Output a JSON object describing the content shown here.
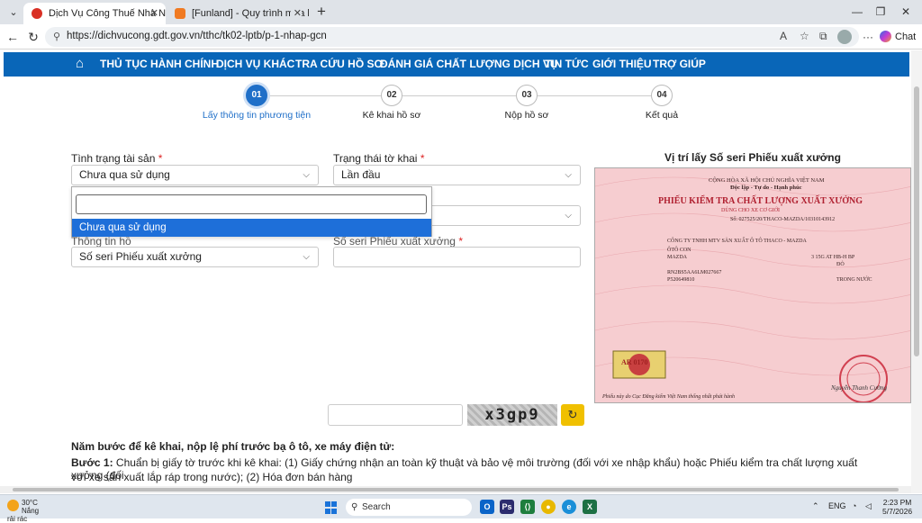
{
  "browser": {
    "tabs": [
      {
        "title": "Dịch Vụ Công Thuế Nhà Nước",
        "active": true
      },
      {
        "title": "[Funland] - Quy trình mua bán xe",
        "active": false
      }
    ],
    "url": "https://dichvucong.gdt.gov.vn/tthc/tk02-lptb/p-1-nhap-gcn",
    "chat_label": "Chat"
  },
  "menu": {
    "items": [
      "THỦ TỤC HÀNH CHÍNH",
      "DỊCH VỤ KHÁC",
      "TRA CỨU HỒ SƠ",
      "ĐÁNH GIÁ CHẤT LƯỢNG DỊCH VỤ",
      "TIN TỨC",
      "GIỚI THIỆU",
      "TRỢ GIÚP"
    ]
  },
  "steps": [
    {
      "num": "01",
      "label": "Lấy thông tin phương tiện",
      "active": true
    },
    {
      "num": "02",
      "label": "Kê khai hồ sơ",
      "active": false
    },
    {
      "num": "03",
      "label": "Nộp hồ sơ",
      "active": false
    },
    {
      "num": "04",
      "label": "Kết quả",
      "active": false
    }
  ],
  "form": {
    "asset_status_label": "Tình trạng tài sản",
    "asset_status_value": "Chưa qua sử dụng",
    "declaration_status_label": "Trạng thái tờ khai",
    "declaration_status_value": "Lần đầu",
    "info_type_label": "Thông tin hồ",
    "info_type_value": "Số seri Phiếu xuất xưởng",
    "serial_number_label": "Số seri Phiếu xuất xưởng",
    "required_mark": "*",
    "dropdown_option": "Chưa qua sử dụng"
  },
  "certificate": {
    "panel_title": "Vị trí lấy Số seri Phiếu xuất xưởng",
    "header1": "CỘNG HÒA XÃ HỘI CHỦ NGHĨA VIỆT NAM",
    "header2": "Độc lập - Tự do - Hạnh phúc",
    "title": "PHIẾU KIỂM TRA CHẤT LƯỢNG XUẤT XƯỞNG",
    "subtitle": "DÙNG CHO XE CƠ GIỚI",
    "serial_line": "Số: 027525/20/THACO-MAZDA/10310143912",
    "manufacturer": "CÔNG TY TNHH MTV SẢN XUẤT Ô TÔ THACO - MAZDA",
    "product": "ÔTÔ CON",
    "brand": "MAZDA",
    "model": "3 15G AT HB-H BP",
    "color": "ĐỎ",
    "chassis": "RN2BS5AA6LM027667",
    "engine": "P520649810",
    "origin": "TRONG NƯỚC",
    "stamp_code": "AR 0170",
    "signer": "Nguyễn Thanh Cường",
    "footer": "Phiếu này do Cục Đăng kiểm Việt Nam thống nhất phát hành"
  },
  "captcha": {
    "text": "x3gp9"
  },
  "guide": {
    "heading": "Năm bước để kê khai, nộp lệ phí trước bạ ô tô, xe máy điện tử:",
    "step1_label": "Bước 1:",
    "step1_text": "Chuẩn bị giấy tờ trước khi kê khai: (1) Giấy chứng nhận an toàn kỹ thuật và bảo vệ môi trường (đối với xe nhập khẩu) hoặc Phiếu kiểm tra chất lượng xuất xưởng (đối",
    "step1_text2": "với xe sản xuất lắp ráp trong nước); (2) Hóa đơn bán hàng"
  },
  "taskbar": {
    "temp": "30°C",
    "weather": "Nắng rải rác",
    "search": "Search",
    "lang": "ENG",
    "time": "2:23 PM",
    "date": "5/7/2026"
  }
}
